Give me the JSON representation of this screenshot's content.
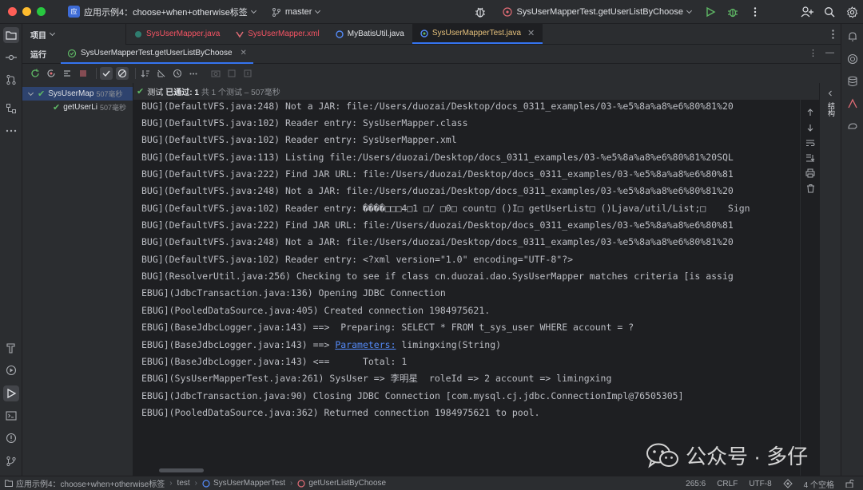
{
  "titlebar": {
    "project_badge": "应",
    "project_name": "应用示例4：choose+when+otherwise标签",
    "branch": "master",
    "run_config": "SysUserMapperTest.getUserListByChoose"
  },
  "project_panel": {
    "title": "项目"
  },
  "tabs": [
    {
      "label": "SysUserMapper.java",
      "color": "#f75464",
      "active": false
    },
    {
      "label": "SysUserMapper.xml",
      "color": "#f75464",
      "active": false
    },
    {
      "label": "MyBatisUtil.java",
      "color": "#dfe1e5",
      "active": false
    },
    {
      "label": "SysUserMapperTest.java",
      "color": "#e5c07b",
      "active": true
    }
  ],
  "run": {
    "title": "运行",
    "tab_label": "SysUserMapperTest.getUserListByChoose"
  },
  "test_status": {
    "prefix": "测试",
    "passed": "已通过: 1",
    "detail": "共 1 个测试 – 507毫秒"
  },
  "tree": [
    {
      "label": "SysUserMap",
      "duration": "507毫秒"
    },
    {
      "label": "getUserLi",
      "duration": "507毫秒"
    }
  ],
  "console": {
    "lines": [
      "BUG](DefaultVFS.java:248) Not a JAR: file:/Users/duozai/Desktop/docs_0311_examples/03-%e5%8a%a8%e6%80%81%20",
      "BUG](DefaultVFS.java:102) Reader entry: SysUserMapper.class",
      "BUG](DefaultVFS.java:102) Reader entry: SysUserMapper.xml",
      "BUG](DefaultVFS.java:113) Listing file:/Users/duozai/Desktop/docs_0311_examples/03-%e5%8a%a8%e6%80%81%20SQL",
      "BUG](DefaultVFS.java:222) Find JAR URL: file:/Users/duozai/Desktop/docs_0311_examples/03-%e5%8a%a8%e6%80%81",
      "BUG](DefaultVFS.java:248) Not a JAR: file:/Users/duozai/Desktop/docs_0311_examples/03-%e5%8a%a8%e6%80%81%20",
      "BUG](DefaultVFS.java:102) Reader entry: ����□□□4□1 □/ □0□ count□ ()I□ getUserList□ ()Ljava/util/List;□    Sign",
      "BUG](DefaultVFS.java:222) Find JAR URL: file:/Users/duozai/Desktop/docs_0311_examples/03-%e5%8a%a8%e6%80%81",
      "BUG](DefaultVFS.java:248) Not a JAR: file:/Users/duozai/Desktop/docs_0311_examples/03-%e5%8a%a8%e6%80%81%20",
      "BUG](DefaultVFS.java:102) Reader entry: <?xml version=\"1.0\" encoding=\"UTF-8\"?>",
      "BUG](ResolverUtil.java:256) Checking to see if class cn.duozai.dao.SysUserMapper matches criteria [is assig",
      "EBUG](JdbcTransaction.java:136) Opening JDBC Connection",
      "EBUG](PooledDataSource.java:405) Created connection 1984975621.",
      "EBUG](BaseJdbcLogger.java:143) ==>  Preparing: SELECT * FROM t_sys_user WHERE account = ?",
      "EBUG](BaseJdbcLogger.java:143) ==> ",
      "EBUG](BaseJdbcLogger.java:143) <==      Total: 1",
      "EBUG](SysUserMapperTest.java:261) SysUser => 李明星  roleId => 2 account => limingxing",
      "EBUG](JdbcTransaction.java:90) Closing JDBC Connection [com.mysql.cj.jdbc.ConnectionImpl@76505305]",
      "EBUG](PooledDataSource.java:362) Returned connection 1984975621 to pool."
    ],
    "params_link": "Parameters:",
    "params_value": " limingxing(String)"
  },
  "sidepanel": {
    "label": "结构"
  },
  "watermark": {
    "text": "公众号 · 多仔"
  },
  "statusbar": {
    "crumbs": [
      "应用示例4：choose+when+otherwise标签",
      "test",
      "SysUserMapperTest",
      "getUserListByChoose"
    ],
    "position": "265:6",
    "line_sep": "CRLF",
    "encoding": "UTF-8",
    "indent": "4 个空格"
  }
}
